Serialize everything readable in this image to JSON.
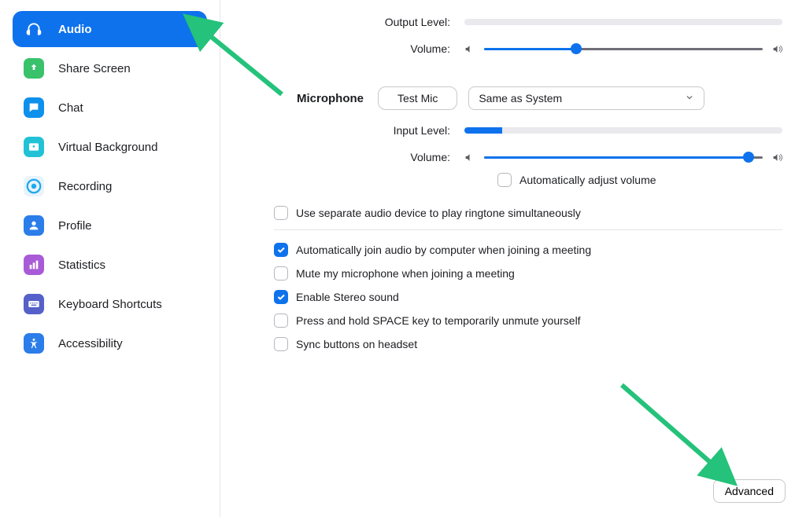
{
  "sidebar": {
    "items": [
      {
        "label": "Audio",
        "active": true,
        "icon": "headphones",
        "bg": "#0e72ed"
      },
      {
        "label": "Share Screen",
        "active": false,
        "icon": "share",
        "bg": "#39c26b"
      },
      {
        "label": "Chat",
        "active": false,
        "icon": "chat",
        "bg": "#0e90ed"
      },
      {
        "label": "Virtual Background",
        "active": false,
        "icon": "image",
        "bg": "#22c2d6"
      },
      {
        "label": "Recording",
        "active": false,
        "icon": "record",
        "bg": "#1ea8f0"
      },
      {
        "label": "Profile",
        "active": false,
        "icon": "user",
        "bg": "#2b7de9"
      },
      {
        "label": "Statistics",
        "active": false,
        "icon": "stats",
        "bg": "#a95bd7"
      },
      {
        "label": "Keyboard Shortcuts",
        "active": false,
        "icon": "keyboard",
        "bg": "#5560c9"
      },
      {
        "label": "Accessibility",
        "active": false,
        "icon": "accessibility",
        "bg": "#2b7de9"
      }
    ]
  },
  "audio": {
    "output_level_label": "Output Level:",
    "output_level_percent": 0,
    "output_volume_label": "Volume:",
    "output_volume_percent": 33,
    "microphone_section_label": "Microphone",
    "test_mic_label": "Test Mic",
    "mic_select_value": "Same as System",
    "input_level_label": "Input Level:",
    "input_level_percent": 12,
    "input_volume_label": "Volume:",
    "input_volume_percent": 95,
    "auto_adjust_label": "Automatically adjust volume",
    "auto_adjust_checked": false,
    "use_separate_label": "Use separate audio device to play ringtone simultaneously",
    "use_separate_checked": false,
    "auto_join_label": "Automatically join audio by computer when joining a meeting",
    "auto_join_checked": true,
    "mute_mic_label": "Mute my microphone when joining a meeting",
    "mute_mic_checked": false,
    "stereo_label": "Enable Stereo sound",
    "stereo_checked": true,
    "space_unmute_label": "Press and hold SPACE key to temporarily unmute yourself",
    "space_unmute_checked": false,
    "sync_headset_label": "Sync buttons on headset",
    "sync_headset_checked": false,
    "advanced_label": "Advanced"
  },
  "colors": {
    "accent": "#0e72ed",
    "arrow": "#24c27a"
  }
}
